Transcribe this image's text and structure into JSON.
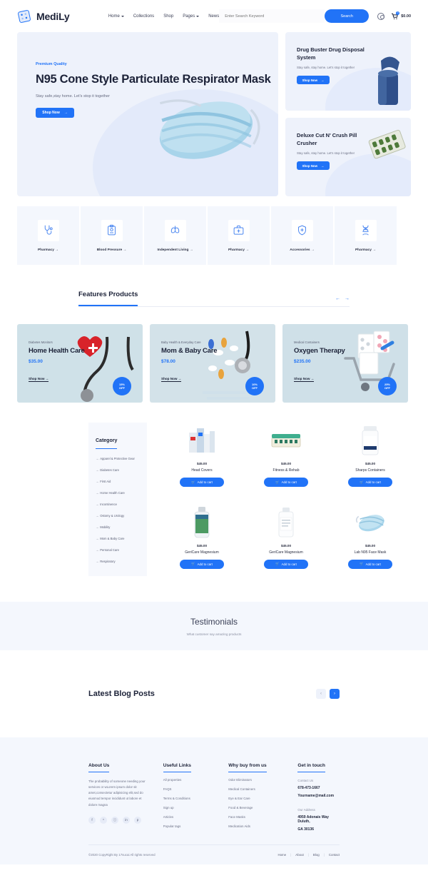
{
  "header": {
    "logo_text": "MediLy",
    "nav": [
      {
        "label": "Home",
        "caret": true
      },
      {
        "label": "Collections",
        "caret": false
      },
      {
        "label": "Shop",
        "caret": false
      },
      {
        "label": "Pages",
        "caret": true
      },
      {
        "label": "News",
        "caret": false
      }
    ],
    "search_placeholder": "Enter Search Keyword",
    "search_button": "Search",
    "cart_total": "$0.00",
    "cart_count": "0"
  },
  "hero": {
    "eyebrow": "Premium Quality",
    "title": "N95 Cone Style Particulate Respirator Mask",
    "subtitle": "Stay safe,stay home. Let's stop it together",
    "cta": "Shop Now"
  },
  "side_banners": [
    {
      "title": "Drug Buster Drug Disposal System",
      "subtitle": "Stay safe, stay home. Let's stop it together",
      "cta": "Shop Now"
    },
    {
      "title": "Deluxe Cut N' Crush Pill Crusher",
      "subtitle": "Stay safe, stay home. Let's stop it together",
      "cta": "Shop Now"
    }
  ],
  "categories_row": [
    {
      "label": "Pharmacy",
      "icon": "stethoscope-icon"
    },
    {
      "label": "Blood Pressure",
      "icon": "clipboard-icon"
    },
    {
      "label": "Independent Living",
      "icon": "lungs-icon"
    },
    {
      "label": "Pharmacy",
      "icon": "first-aid-kit-icon"
    },
    {
      "label": "Accessories",
      "icon": "shield-cross-icon"
    },
    {
      "label": "Pharmacy",
      "icon": "dna-icon"
    }
  ],
  "features": {
    "title": "Features Products",
    "prev": "←",
    "next": "→",
    "cards": [
      {
        "eyebrow": "Diabetes Monitors",
        "title": "Home Health Care",
        "price": "$35.00",
        "cta": "Shop Now",
        "discount_pct": "15%",
        "discount_label": "OFF",
        "bg": "#cfe1e8"
      },
      {
        "eyebrow": "Baby Health & Everyday Care",
        "title": "Mom & Baby Care",
        "price": "$78.00",
        "cta": "Shop Now",
        "discount_pct": "10%",
        "discount_label": "OFF",
        "bg": "#d3e2e9"
      },
      {
        "eyebrow": "Medical Containers",
        "title": "Oxygen Therapy",
        "price": "$235.00",
        "cta": "Shop Now",
        "discount_pct": "25%",
        "discount_label": "OFF",
        "bg": "#cfe0e8"
      }
    ]
  },
  "shop": {
    "category_title": "Category",
    "category_links": [
      "Apparel & Protective Gear",
      "Diabetes Care",
      "First Aid",
      "Home Health Care",
      "Incontinence",
      "Ostomy & Urology",
      "Mobility",
      "Mom & Baby Care",
      "Personal Care",
      "Respiratory"
    ],
    "add_to_cart": "Add to cart",
    "products": [
      {
        "price": "$45.00",
        "name": "Head Covers",
        "image": "first-aid-products-image"
      },
      {
        "price": "$45.00",
        "name": "Fitness & Rehab",
        "image": "pill-organizer-image"
      },
      {
        "price": "$45.00",
        "name": "Sharps Containers",
        "image": "white-bottle-image"
      },
      {
        "price": "$45.00",
        "name": "GeriCare Magnesium",
        "image": "green-bottle-image"
      },
      {
        "price": "$45.00",
        "name": "GeriCare Magnesium",
        "image": "supplement-bottle-image"
      },
      {
        "price": "$45.00",
        "name": "Lab N95 Face Mask",
        "image": "face-mask-image"
      }
    ]
  },
  "testimonials": {
    "title": "Testimonials",
    "subtitle": "What customer say amazing products"
  },
  "blog": {
    "title": "Latest Blog Posts",
    "prev": "‹",
    "next": "›"
  },
  "footer": {
    "about": {
      "title": "About Us",
      "text": "The probability of someone needing your services or wLorem ipsum dolor sit amet,consectetur adipisicing elit,sed do eiusmod tempor incididunt ut labore et dolore magna",
      "socials": [
        "f",
        "ᵛ",
        "ⓘ",
        "in",
        "p"
      ]
    },
    "useful": {
      "title": "Useful Links",
      "links": [
        "All properties",
        "FAQS",
        "Terms & Conditions",
        "Sign up",
        "Articles",
        "Popular tags"
      ]
    },
    "whybuy": {
      "title": "Why buy from us",
      "links": [
        "Odor Eliminators",
        "Medical Containers",
        "Eye & Ear Care",
        "Food & Beverage",
        "Face Masks",
        "Medication Aids"
      ]
    },
    "contact": {
      "title": "Get in touch",
      "contact_label": "Contact Us",
      "phone": "678-473-1667",
      "email": "Yourname@mail.com",
      "address_label": "Our Address",
      "address_line1": "4959 Adonais Way Duluth,",
      "address_line2": "GA 30136"
    },
    "copyright": "©2020 CopyRight By 17sucai All rights reserved",
    "bottom_links": [
      "Home",
      "About",
      "Blog",
      "Contact"
    ]
  },
  "colors": {
    "accent": "#2173f7",
    "dark": "#1c2238",
    "light_bg": "#eef2fb"
  }
}
